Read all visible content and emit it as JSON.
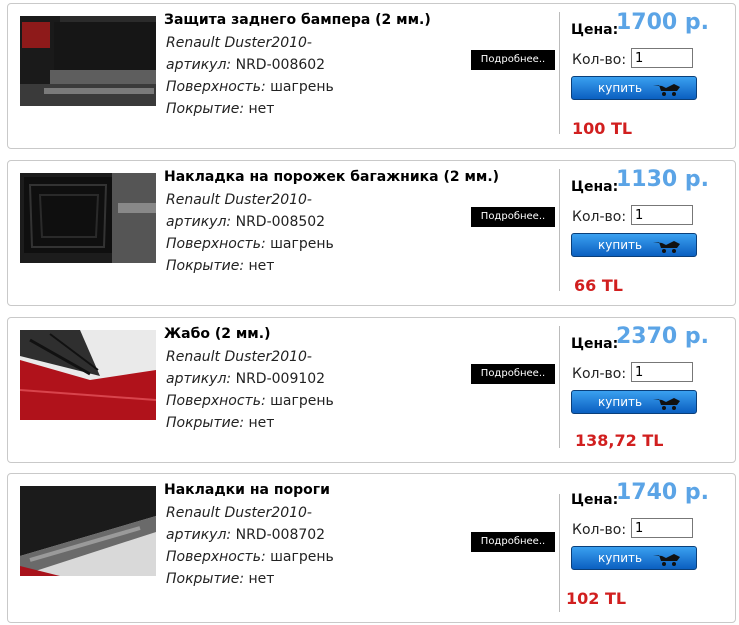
{
  "common": {
    "more_label": "Подробнее..",
    "price_label": "Цена:",
    "qty_label": "Кол-во:",
    "buy_label": "купить",
    "brand_model": "Renault Duster2010-",
    "sku_label": "артикул:",
    "surface_label": "Поверхность:",
    "coating_label": "Покрытие:"
  },
  "products": [
    {
      "title": "Защита заднего бампера (2 мм.)",
      "sku": "NRD-008602",
      "surface": "шагрень",
      "coating": "нет",
      "price": "1700 р.",
      "qty": "1",
      "tl_price": "100 TL",
      "image_icon": "rear-bumper-photo"
    },
    {
      "title": "Накладка на порожек багажника (2 мм.)",
      "sku": "NRD-008502",
      "surface": "шагрень",
      "coating": "нет",
      "price": "1130 р.",
      "qty": "1",
      "tl_price": "66 TL",
      "image_icon": "trunk-sill-photo"
    },
    {
      "title": "Жабо (2 мм.)",
      "sku": "NRD-009102",
      "surface": "шагрень",
      "coating": "нет",
      "price": "2370 р.",
      "qty": "1",
      "tl_price": "138,72 TL",
      "image_icon": "windshield-cowl-photo"
    },
    {
      "title": "Накладки на пороги",
      "sku": "NRD-008702",
      "surface": "шагрень",
      "coating": "нет",
      "price": "1740 р.",
      "qty": "1",
      "tl_price": "102 TL",
      "image_icon": "door-sill-photo"
    }
  ],
  "colors": {
    "price": "#5ba4e6",
    "tl_price": "#d11f1f",
    "buy_button": "#1a78d8",
    "more_button": "#000000"
  }
}
